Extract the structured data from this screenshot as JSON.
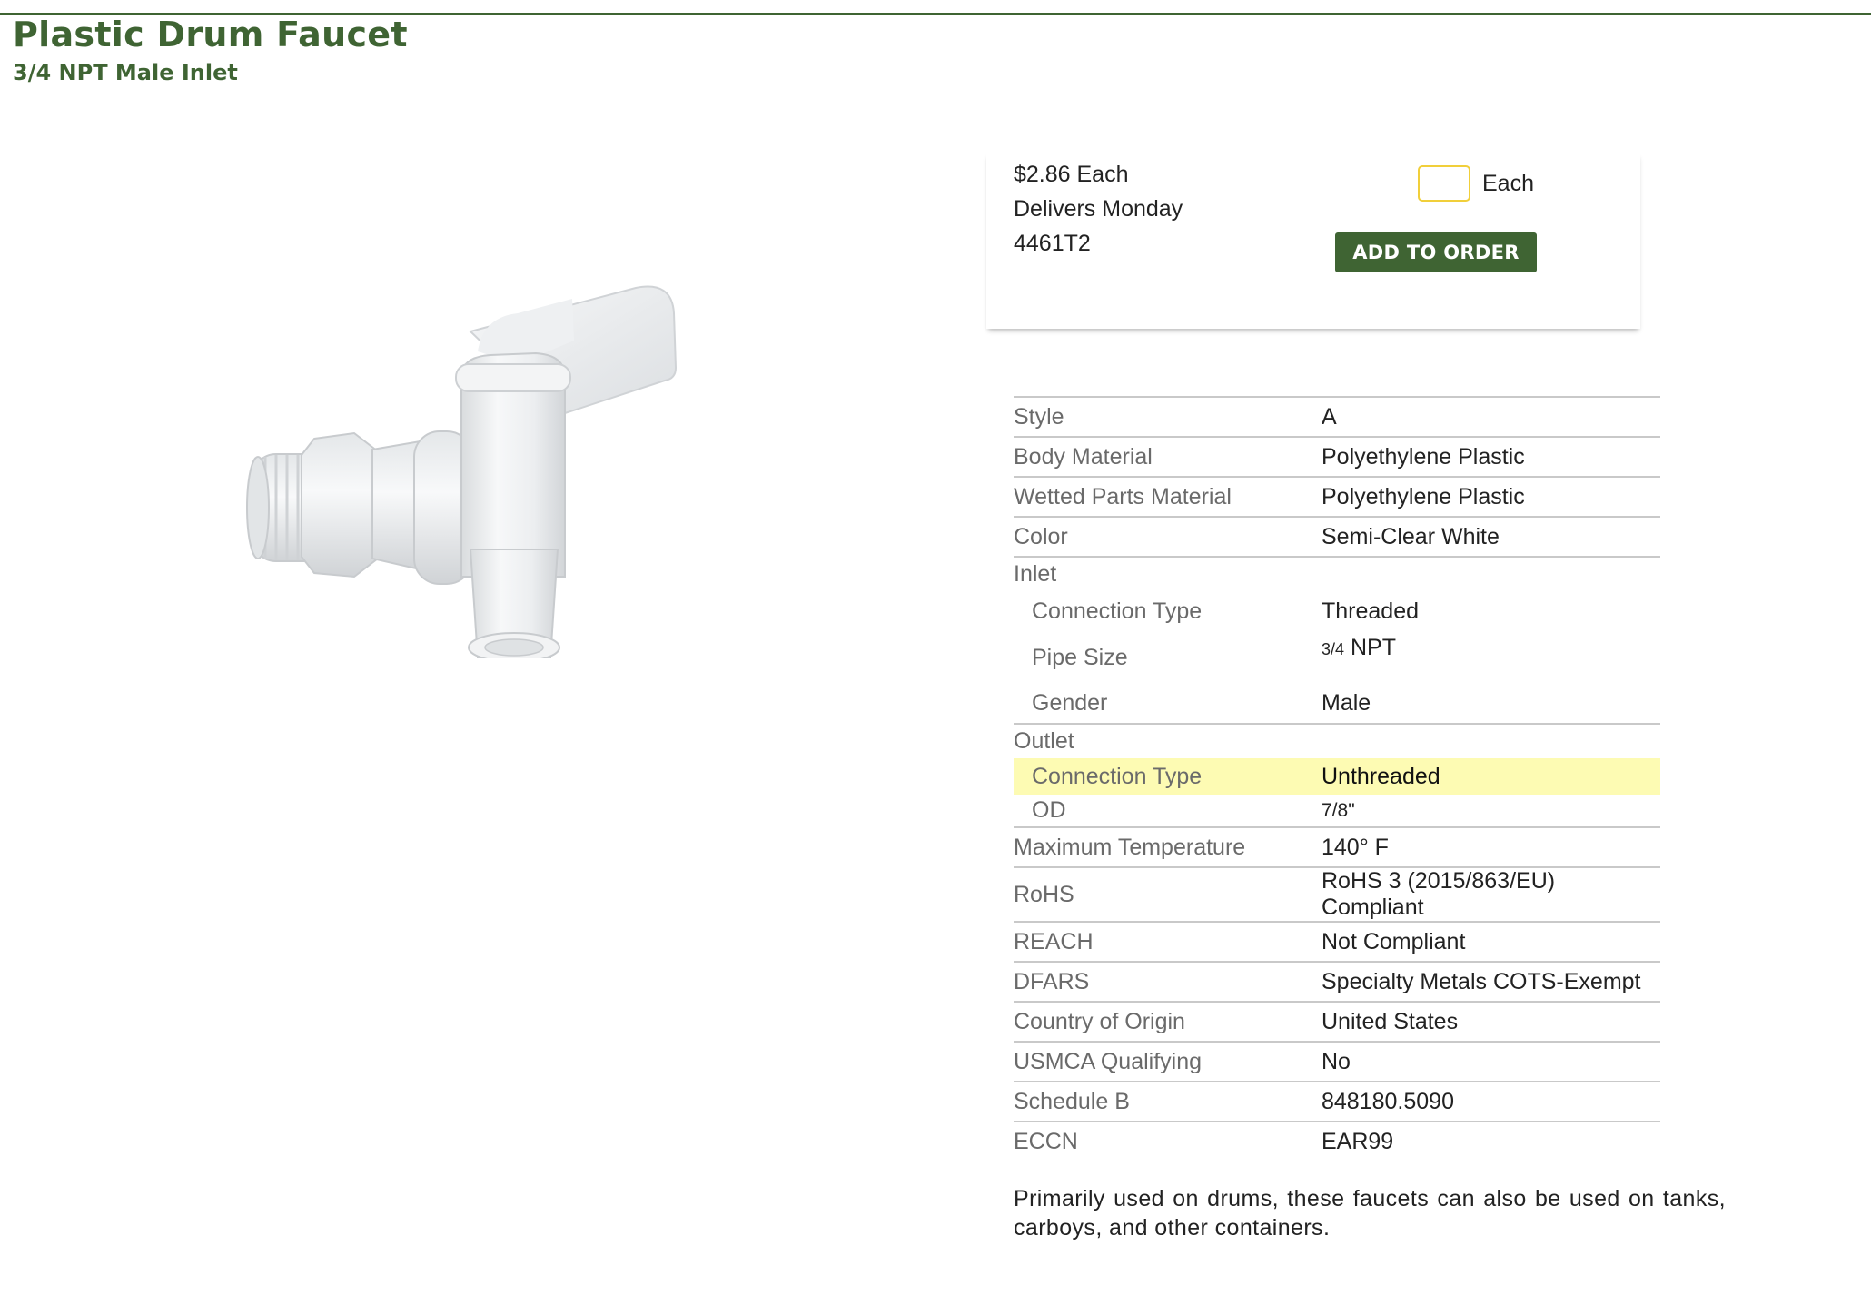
{
  "product": {
    "title": "Plastic Drum Faucet",
    "subtitle": "3/4 NPT Male Inlet"
  },
  "image": {
    "icon": "drum-faucet-image"
  },
  "buy_box": {
    "price": "$2.86 Each",
    "delivery": "Delivers Monday",
    "part_number": "4461T2",
    "quantity_value": "",
    "quantity_unit": "Each",
    "add_button": "ADD TO ORDER"
  },
  "specs": {
    "style": {
      "label": "Style",
      "value": "A"
    },
    "body_material": {
      "label": "Body Material",
      "value": "Polyethylene Plastic"
    },
    "wetted_parts": {
      "label": "Wetted Parts Material",
      "value": "Polyethylene Plastic"
    },
    "color": {
      "label": "Color",
      "value": "Semi-Clear White"
    },
    "inlet": {
      "label": "Inlet",
      "connection_type": {
        "label": "Connection Type",
        "value": "Threaded"
      },
      "pipe_size": {
        "label": "Pipe Size",
        "value_fraction": "3/4",
        "value_unit": "NPT"
      },
      "gender": {
        "label": "Gender",
        "value": "Male"
      }
    },
    "outlet": {
      "label": "Outlet",
      "connection_type": {
        "label": "Connection Type",
        "value": "Unthreaded"
      },
      "od": {
        "label": "OD",
        "value": "7/8\""
      }
    },
    "max_temp": {
      "label": "Maximum Temperature",
      "value": "140° F"
    },
    "rohs": {
      "label": "RoHS",
      "value": "RoHS 3 (2015/863/EU) Compliant"
    },
    "reach": {
      "label": "REACH",
      "value": "Not Compliant"
    },
    "dfars": {
      "label": "DFARS",
      "value": "Specialty Metals COTS-Exempt"
    },
    "country": {
      "label": "Country of Origin",
      "value": "United States"
    },
    "usmca": {
      "label": "USMCA Qualifying",
      "value": "No"
    },
    "schedule_b": {
      "label": "Schedule B",
      "value": "848180.5090"
    },
    "eccn": {
      "label": "ECCN",
      "value": "EAR99"
    }
  },
  "description": "Primarily used on drums, these faucets can also be used on tanks, carboys, and other containers.",
  "colors": {
    "brand_green": "#3f6433",
    "highlight_yellow": "#fdfbb3",
    "input_border": "#f1cf3a"
  }
}
